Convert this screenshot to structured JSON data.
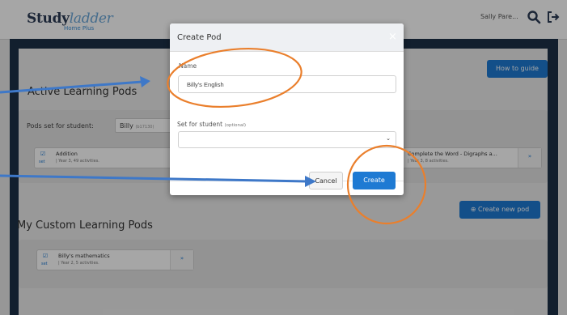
{
  "header": {
    "logo_main": "Study",
    "logo_italic": "ladder",
    "logo_sub": "Home Plus",
    "user_name": "Sally Pare...",
    "icons": [
      "search-icon",
      "logout-icon"
    ]
  },
  "page": {
    "how_to_guide": "How to guide",
    "active_title": "Active Learning Pods",
    "pods_set_for_label": "Pods set for student:",
    "student_select_value": "Billy",
    "student_select_hint": "(b17130)",
    "active_cards": [
      {
        "title": "Addition",
        "meta": "| Year 3, 49 activities.",
        "set_label": "set"
      },
      {
        "title": "Complete the Word - Digraphs a...",
        "meta": "| Year 3, 8 activities.",
        "set_label": "set"
      }
    ],
    "create_new_pod": "Create new pod",
    "custom_title": "My Custom Learning Pods",
    "custom_cards": [
      {
        "title": "Billy's mathematics",
        "meta": "| Year 2, 5 activities.",
        "set_label": "set"
      }
    ]
  },
  "modal": {
    "title": "Create Pod",
    "close_symbol": "×",
    "name_label": "Name",
    "name_value": "Billy's English",
    "student_label": "Set for student",
    "student_label_hint": "(optional)",
    "student_value": "",
    "cancel_label": "Cancel",
    "create_label": "Create"
  },
  "annotations": {
    "arrow_color": "#3e78c8",
    "circle_color": "#ea7f2c"
  }
}
